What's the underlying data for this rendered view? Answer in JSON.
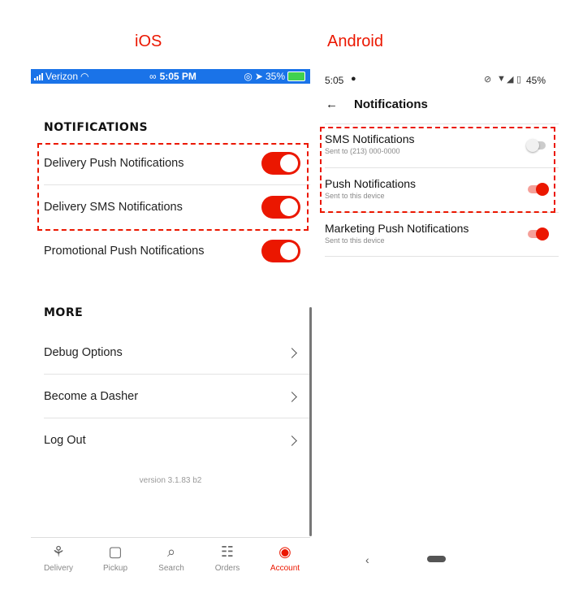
{
  "headers": {
    "ios": "iOS",
    "android": "Android"
  },
  "ios": {
    "status": {
      "carrier": "Verizon",
      "time": "5:05 PM",
      "battery": "35%"
    },
    "notifications_heading": "NOTIFICATIONS",
    "notifications": [
      {
        "label": "Delivery Push Notifications",
        "on": true
      },
      {
        "label": "Delivery SMS Notifications",
        "on": true
      },
      {
        "label": "Promotional Push Notifications",
        "on": true
      }
    ],
    "more_heading": "MORE",
    "more": [
      {
        "label": "Debug Options"
      },
      {
        "label": "Become a Dasher"
      },
      {
        "label": "Log Out"
      }
    ],
    "version": "version 3.1.83 b2",
    "tabs": [
      {
        "label": "Delivery",
        "icon": "scooter-icon",
        "active": false
      },
      {
        "label": "Pickup",
        "icon": "bag-icon",
        "active": false
      },
      {
        "label": "Search",
        "icon": "search-icon",
        "active": false
      },
      {
        "label": "Orders",
        "icon": "receipt-icon",
        "active": false
      },
      {
        "label": "Account",
        "icon": "account-icon",
        "active": true
      }
    ],
    "accent": "#eb1700",
    "status_bar_color": "#1a73e8"
  },
  "android": {
    "status": {
      "time": "5:05",
      "battery": "45%"
    },
    "title": "Notifications",
    "rows": [
      {
        "title": "SMS Notifications",
        "sub": "Sent to (213) 000-0000",
        "on": false
      },
      {
        "title": "Push Notifications",
        "sub": "Sent to this device",
        "on": true
      },
      {
        "title": "Marketing Push Notifications",
        "sub": "Sent to this device",
        "on": true
      }
    ]
  }
}
